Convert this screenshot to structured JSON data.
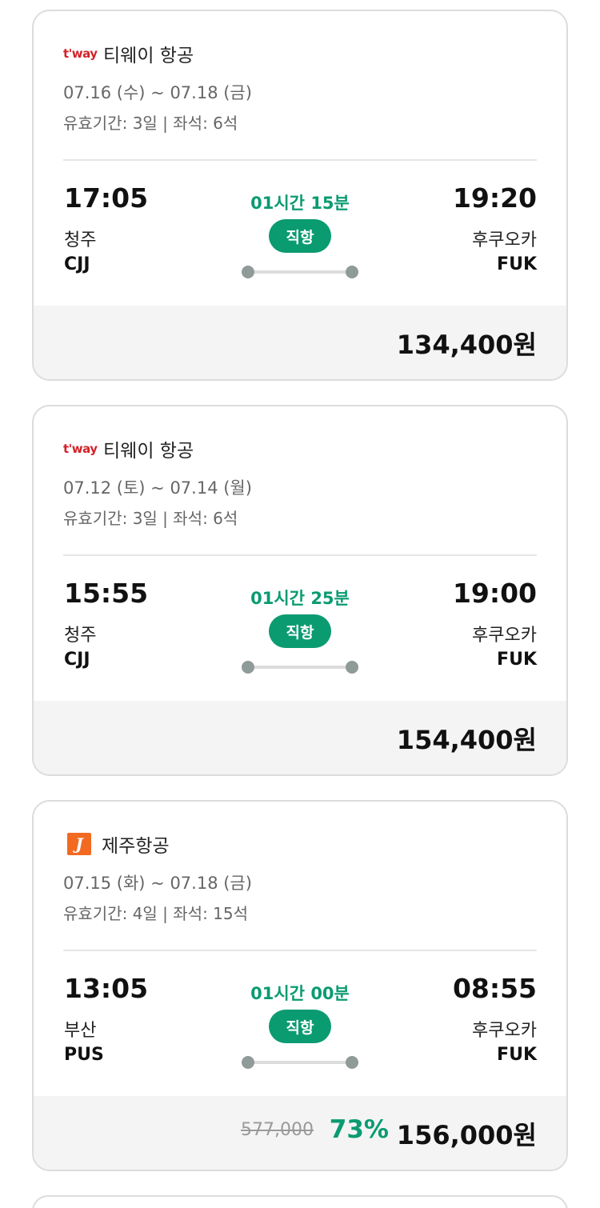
{
  "flights": [
    {
      "airline": "티웨이 항공",
      "logo_text": "t'way",
      "dates": "07.16 (수) ~ 07.18 (금)",
      "meta": "유효기간: 3일 | 좌석: 6석",
      "dep_time": "17:05",
      "dep_city": "청주",
      "dep_code": "CJJ",
      "arr_time": "19:20",
      "arr_city": "후쿠오카",
      "arr_code": "FUK",
      "duration": "01시간 15분",
      "badge": "직항",
      "price": "134,400원"
    },
    {
      "airline": "티웨이 항공",
      "logo_text": "t'way",
      "dates": "07.12 (토) ~ 07.14 (월)",
      "meta": "유효기간: 3일 | 좌석: 6석",
      "dep_time": "15:55",
      "dep_city": "청주",
      "dep_code": "CJJ",
      "arr_time": "19:00",
      "arr_city": "후쿠오카",
      "arr_code": "FUK",
      "duration": "01시간 25분",
      "badge": "직항",
      "price": "154,400원"
    },
    {
      "airline": "제주항공",
      "logo_text": "J",
      "dates": "07.15 (화) ~ 07.18 (금)",
      "meta": "유효기간: 4일 | 좌석: 15석",
      "dep_time": "13:05",
      "dep_city": "부산",
      "dep_code": "PUS",
      "arr_time": "08:55",
      "arr_city": "후쿠오카",
      "arr_code": "FUK",
      "duration": "01시간 00분",
      "badge": "직항",
      "original_price": "577,000",
      "discount": "73%",
      "price": "156,000원"
    }
  ],
  "colors": {
    "accent": "#0b9b71",
    "tway_red": "#d2232a",
    "jeju_orange": "#f26a21"
  }
}
